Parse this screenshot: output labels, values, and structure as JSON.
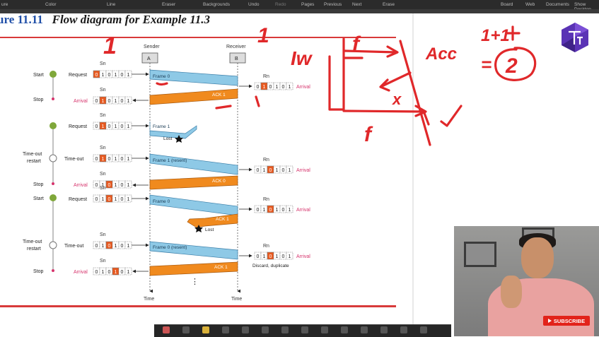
{
  "toolbar": {
    "items": [
      "ure",
      "Color",
      "Line",
      "Eraser",
      "Backgrounds",
      "Undo",
      "Redo",
      "Pages",
      "Previous",
      "Next",
      "Erase",
      "Board",
      "Web",
      "Documents",
      "Show Desktop"
    ]
  },
  "figure": {
    "number": "ure 11.11",
    "title": "Flow diagram for Example 11.3"
  },
  "diagram": {
    "sender_label": "Sender",
    "sender_box": "A",
    "receiver_label": "Receiver",
    "receiver_box": "B",
    "sn": "Sn",
    "rn": "Rn",
    "time": "Time",
    "seq": [
      "0",
      "1",
      "0",
      "1",
      "0",
      "1"
    ],
    "events": {
      "start": "Start",
      "stop": "Stop",
      "timeout_1": "Time-out",
      "timeout_2": "restart",
      "request": "Request",
      "arrival": "Arrival",
      "timeout_row": "Time-out",
      "lost": "Lost",
      "discard": "Discard, duplicate"
    },
    "frames": {
      "f0": "Frame 0",
      "ack1": "ACK 1",
      "f1": "Frame 1",
      "f1r": "Frame 1 (resent)",
      "ack0": "ACK 0",
      "f0b": "Frame 0",
      "ack1b": "ACK 1",
      "f0r": "Frame 0 (resent)",
      "ack1c": "ACK 1"
    }
  },
  "annotations": {
    "one_a": "1",
    "one_b": "1",
    "iw": "Iw",
    "f_top": "f",
    "f_bottom": "f",
    "acc": "Acc",
    "sum": "1+1",
    "equals": "=",
    "two": "2"
  },
  "webcam": {
    "subscribe": "SUBSCRIBE"
  },
  "colors": {
    "frame_blue": "#8ec9e6",
    "ack_orange": "#f08a1e",
    "marker_red": "#e0282a",
    "sn_orange": "#e8591f",
    "arrival_pink": "#d6336c",
    "start_green": "#7fa73a"
  }
}
